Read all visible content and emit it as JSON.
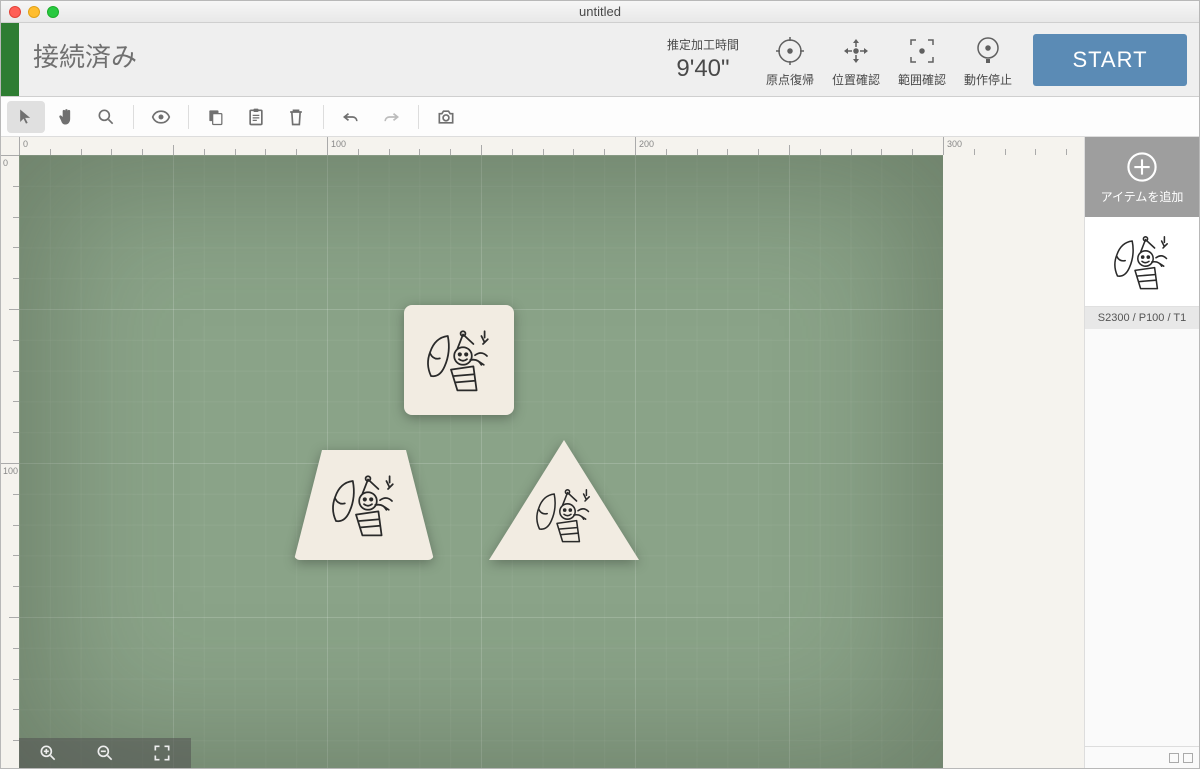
{
  "window": {
    "title": "untitled"
  },
  "header": {
    "status": "接続済み",
    "est_label": "推定加工時間",
    "est_value": "9'40\"",
    "buttons": {
      "origin": "原点復帰",
      "position": "位置確認",
      "range": "範囲確認",
      "stop": "動作停止"
    },
    "start": "START"
  },
  "ruler": {
    "h": [
      "0",
      "100",
      "200",
      "300"
    ],
    "v": [
      "0",
      "100"
    ]
  },
  "rpanel": {
    "add_label": "アイテムを追加",
    "item_params": "S2300 / P100 / T1"
  }
}
